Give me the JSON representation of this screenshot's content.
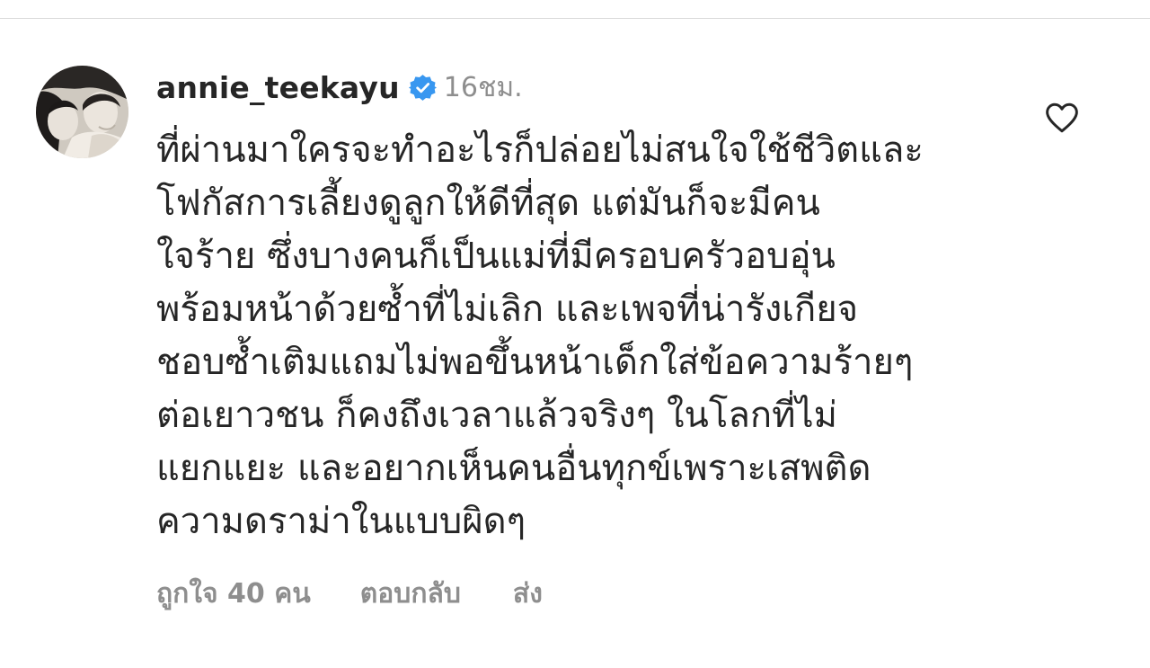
{
  "comment": {
    "username": "annie_teekayu",
    "verified": true,
    "time": "16ชม.",
    "body_lines": [
      "ที่ผ่านมาใครจะทำอะไรก็ปล่อยไม่สนใจใช้ชีวิตและ",
      "โฟกัสการเลี้ยงดูลูกให้ดีที่สุด แต่มันก็จะมีคน",
      "ใจร้าย ซึ่งบางคนก็เป็นแม่ที่มีครอบครัวอบอุ่น",
      "พร้อมหน้าด้วยซ้ำที่ไม่เลิก และเพจที่น่ารังเกียจ",
      "ชอบซ้ำเติมแถมไม่พอขึ้นหน้าเด็กใส่ข้อความร้ายๆ",
      "ต่อเยาวชน ก็คงถึงเวลาแล้วจริงๆ ในโลกที่ไม่",
      "แยกแยะ และอยากเห็นคนอื่นทุกข์เพราะเสพติด",
      "ความดราม่าในแบบผิดๆ"
    ],
    "likes_label": "ถูกใจ 40 คน",
    "reply_label": "ตอบกลับ",
    "send_label": "ส่ง"
  },
  "colors": {
    "text": "#262626",
    "muted": "#8e8e8e",
    "verified_badge": "#3897f0",
    "divider": "#dbdbdb"
  },
  "icons": {
    "verified": "verified-badge-icon",
    "like": "heart-outline-icon"
  }
}
